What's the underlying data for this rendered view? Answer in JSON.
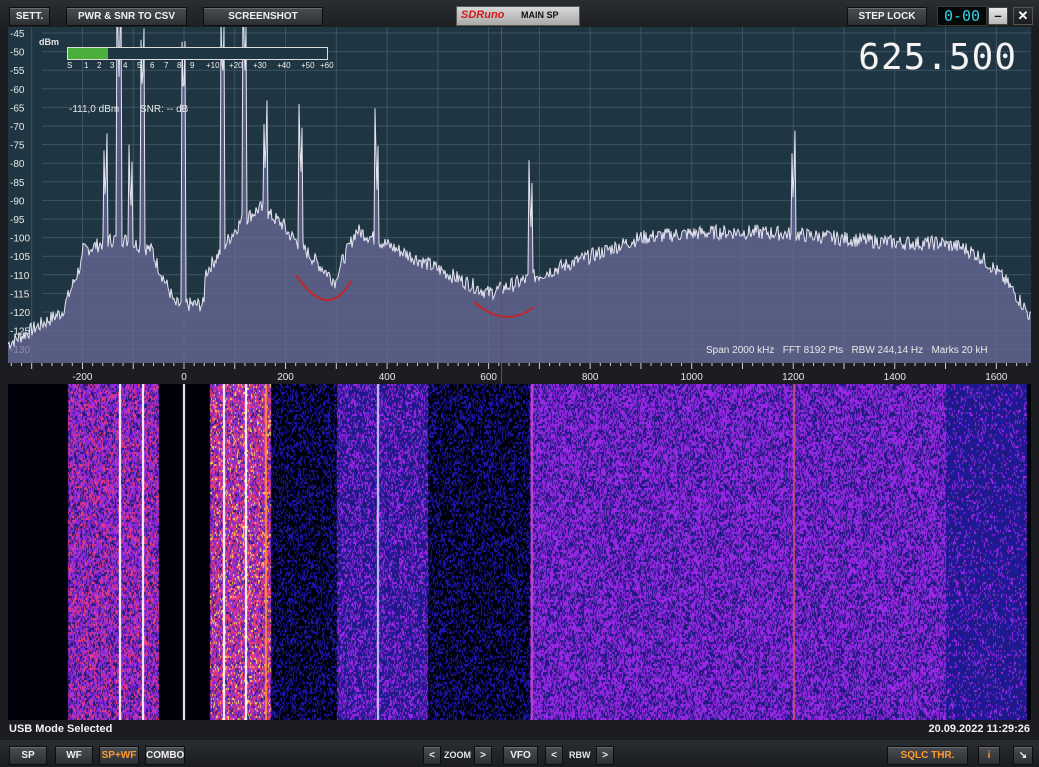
{
  "toolbar": {
    "settings": "SETT.",
    "pwr_snr_csv": "PWR & SNR TO CSV",
    "screenshot": "SCREENSHOT",
    "logo": "SDRuno",
    "window_title": "MAIN SP",
    "step_lock": "STEP LOCK",
    "display_digits": "0-00",
    "minimize": "–",
    "close": "✕"
  },
  "spectrum": {
    "frequency_display": "625.500",
    "unit_label": "dBm",
    "level_text": "-111,0 dBm",
    "snr_text": "SNR: -- dB",
    "info": "Span 2000 kHz   FFT 8192 Pts   RBW 244,14 Hz   Marks 20 kH",
    "smeter_labels": [
      "S",
      "1",
      "2",
      "3",
      "4",
      "5",
      "6",
      "7",
      "8",
      "9",
      "+10",
      "+20",
      "+30",
      "+40",
      "+50",
      "+60"
    ],
    "smeter_level_fraction": 0.155,
    "y_ticks": [
      "-45",
      "-50",
      "-55",
      "-60",
      "-65",
      "-70",
      "-75",
      "-80",
      "-85",
      "-90",
      "-95",
      "-100",
      "-105",
      "-110",
      "-115",
      "-120",
      "-125",
      "-130"
    ],
    "x_ticks": [
      "-200",
      "0",
      "200",
      "400",
      "600",
      "800",
      "1000",
      "1200",
      "1400",
      "1600"
    ]
  },
  "status": {
    "mode": "USB Mode Selected",
    "datetime": "20.09.2022 11:29:26"
  },
  "bottom": {
    "sp": "SP",
    "wf": "WF",
    "spwf": "SP+WF",
    "combo": "COMBO",
    "zoom_left": "<",
    "zoom": "ZOOM",
    "zoom_right": ">",
    "vfo": "VFO",
    "rbw_left": "<",
    "rbw": "RBW",
    "rbw_right": ">",
    "sqlc": "SQLC THR.",
    "info_btn": "i",
    "resize_icon": "resize-icon"
  },
  "colors": {
    "spectrum_bg": "#1f3541",
    "trace_fill": "#6b6a98",
    "vfo_marker": "#c8282a",
    "smeter_green": "#4caf3c",
    "accent_orange": "#ff9a2a"
  }
}
